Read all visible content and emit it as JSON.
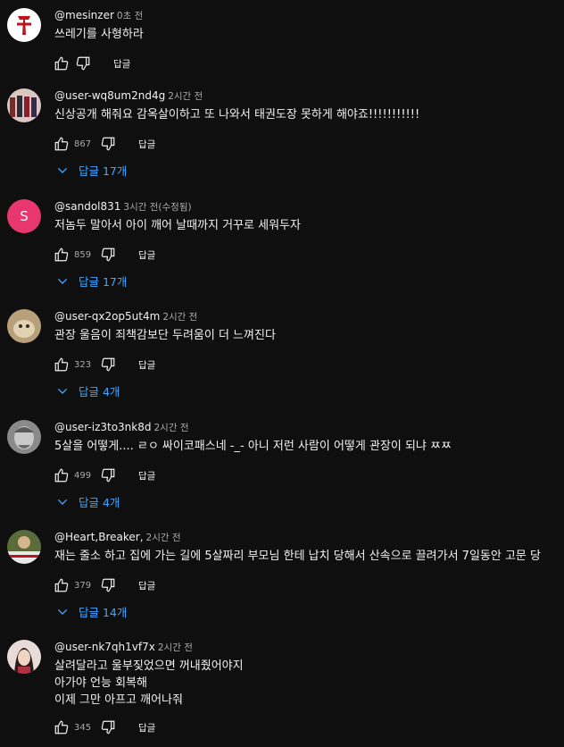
{
  "comments": [
    {
      "handle": "@mesinzer",
      "time": "0초 전",
      "text": "쓰레기를 사형하라",
      "likes": "",
      "reply_label": "답글",
      "replies": ""
    },
    {
      "handle": "@user-wq8um2nd4g",
      "time": "2시간 전",
      "text": "신상공개 해줘요 감옥살이하고 또 나와서 태권도장 못하게 해야죠!!!!!!!!!!!",
      "likes": "867",
      "reply_label": "답글",
      "replies": "답글 17개"
    },
    {
      "handle": "@sandol831",
      "time": "3시간 전(수정됨)",
      "text": "저놈두 말아서  아이 깨어 날때까지  거꾸로 세워두자",
      "likes": "859",
      "reply_label": "답글",
      "replies": "답글 17개",
      "avatar_letter": "S"
    },
    {
      "handle": "@user-qx2op5ut4m",
      "time": "2시간 전",
      "text": "관장 울음이 죄책감보단 두려움이 더 느껴진다",
      "likes": "323",
      "reply_label": "답글",
      "replies": "답글 4개"
    },
    {
      "handle": "@user-iz3to3nk8d",
      "time": "2시간 전",
      "text": "5살을 어떻게.... ㄹㅇ 싸이코패스네 -_- 아니 저런 사람이 어떻게 관장이 되냐 ㅉㅉ",
      "likes": "499",
      "reply_label": "답글",
      "replies": "답글 4개"
    },
    {
      "handle": "@Heart,Breaker,",
      "time": "2시간 전",
      "text": "재는 줄소 하고 집에 가는 길에 5살짜리 부모님 한테 납치 당해서 산속으로 끌려가서 7일동안 고문 당",
      "likes": "379",
      "reply_label": "답글",
      "replies": "답글 14개"
    },
    {
      "handle": "@user-nk7qh1vf7x",
      "time": "2시간 전",
      "text_lines": [
        "살려달라고 울부짖었으면 꺼내줬어야지",
        "아가야 언능 회복해",
        "이제 그만 아프고 깨어나줘"
      ],
      "likes": "345",
      "reply_label": "답글",
      "replies": ""
    }
  ],
  "colors": {
    "background": "#0f0f0f",
    "text": "#f1f1f1",
    "secondary": "#aaaaaa",
    "link": "#3ea6ff",
    "letter_avatar": "#e8366f"
  },
  "icons": [
    "thumbs-up-icon",
    "thumbs-down-icon",
    "chevron-down-icon"
  ]
}
